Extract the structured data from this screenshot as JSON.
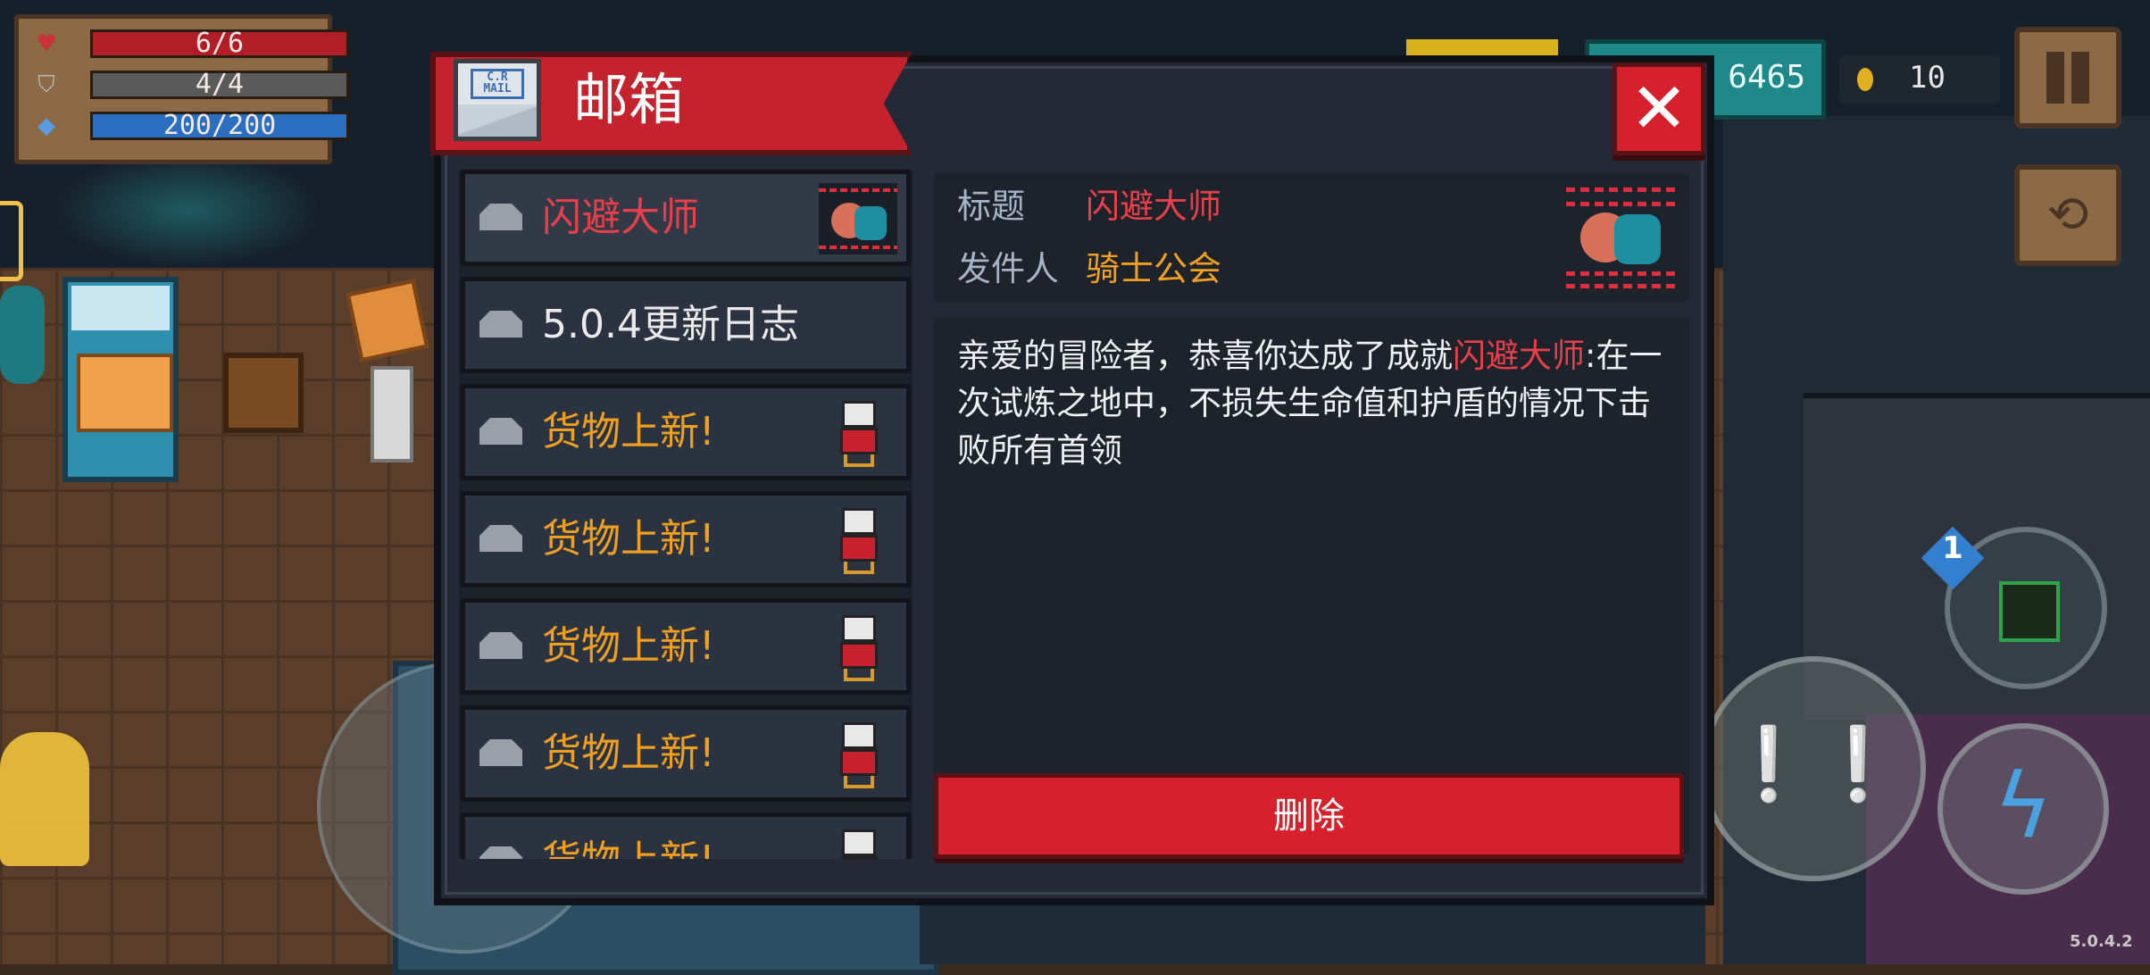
{
  "hud": {
    "hp": "6/6",
    "armor": "4/4",
    "energy": "200/200",
    "gems": "6465",
    "coins": "10",
    "version": "5.0.4.2",
    "weapon_badge": "1",
    "icons": {
      "hp": "heart-icon",
      "armor": "shield-icon",
      "energy": "diamond-icon",
      "pause": "pause-icon",
      "swap": "swap-icon",
      "skill": "skill-icon",
      "dash": "lightning-icon"
    }
  },
  "mailbox": {
    "title": "邮箱",
    "icon_text": "C.R MAIL",
    "close_glyph": "✕",
    "items": [
      {
        "label": "闪避大师",
        "color": "#e8404a",
        "thumb": "hero",
        "selected": true
      },
      {
        "label": "5.0.4更新日志",
        "color": "#eaeaea",
        "thumb": "none"
      },
      {
        "label": "货物上新!",
        "color": "#f0a020",
        "thumb": "merchant-cat"
      },
      {
        "label": "货物上新!",
        "color": "#f0a020",
        "thumb": "merchant-cat"
      },
      {
        "label": "货物上新!",
        "color": "#f0a020",
        "thumb": "merchant-cat"
      },
      {
        "label": "货物上新!",
        "color": "#f0a020",
        "thumb": "merchant-cat"
      },
      {
        "label": "货物上新!",
        "color": "#f0a020",
        "thumb": "merchant-cat"
      }
    ],
    "detail": {
      "subject_key": "标题",
      "subject_value": "闪避大师",
      "sender_key": "发件人",
      "sender_value": "骑士公会",
      "body_before": "亲爱的冒险者，恭喜你达成了成就",
      "body_highlight": "闪避大师",
      "body_after": ":在一次试炼之地中，不损失生命值和护盾的情况下击败所有首领",
      "delete_label": "删除"
    }
  },
  "colors": {
    "accent_red": "#d6202c",
    "text_red": "#e8404a",
    "text_orange": "#f0a020",
    "sender_yellow": "#f0a020",
    "panel_bg": "#242a35"
  }
}
